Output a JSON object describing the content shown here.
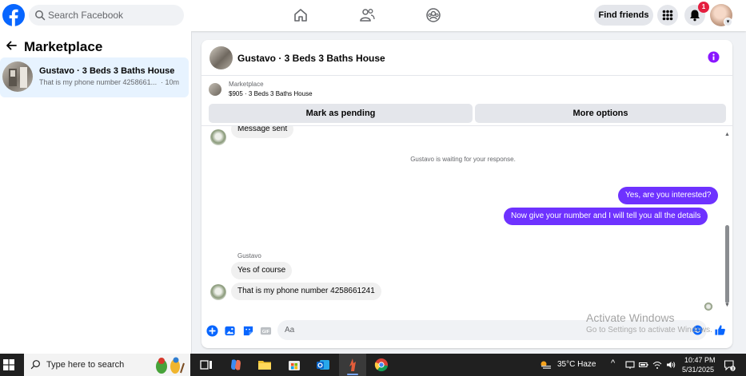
{
  "topbar": {
    "search_placeholder": "Search Facebook",
    "find_friends_label": "Find friends",
    "notification_count": "1"
  },
  "left_panel": {
    "title": "Marketplace",
    "conversation": {
      "name": "Gustavo · 3 Beds 3 Baths House",
      "snippet": "That is my phone number 4258661...",
      "time": "· 10m"
    }
  },
  "chat": {
    "title": "Gustavo · 3 Beds 3 Baths House",
    "listing_label": "Marketplace",
    "listing_price": "$905 · 3 Beds 3 Baths House",
    "mark_pending_label": "Mark as pending",
    "more_options_label": "More options",
    "messages": {
      "msg1": "Message sent",
      "system_note": "Gustavo is waiting for your response.",
      "out1": "Yes, are you interested?",
      "out2": "Now give your number and I will tell you all the details",
      "sender": "Gustavo",
      "in1": "Yes of course",
      "in2": "That is my phone number 4258661241"
    },
    "composer_placeholder": "Aa"
  },
  "watermark": {
    "line1": "Activate Windows",
    "line2": "Go to Settings to activate Windows."
  },
  "taskbar": {
    "search_placeholder": "Type here to search",
    "weather": "35°C  Haze",
    "time": "10:47 PM",
    "date": "5/31/2025",
    "notif_count": "3"
  },
  "colors": {
    "fb_blue": "#0866ff",
    "messenger_purple": "#6e32ff",
    "info_purple": "#8a16ff",
    "selection": "#e7f3ff"
  }
}
